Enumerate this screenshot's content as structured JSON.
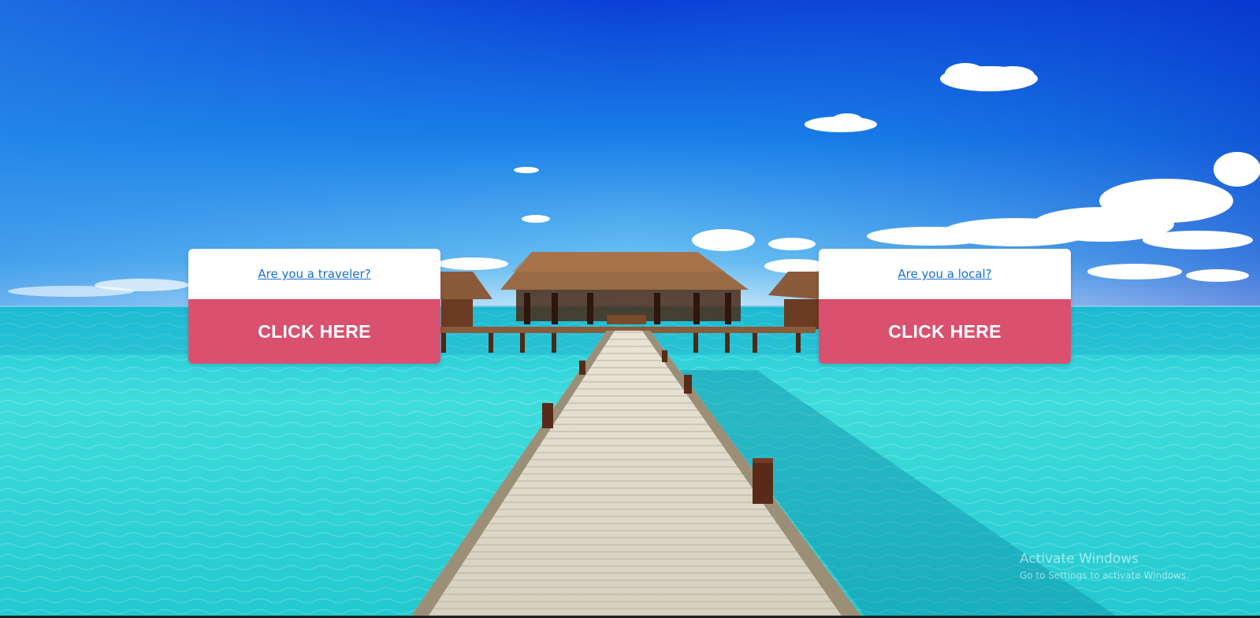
{
  "traveler_card": {
    "question": "Are you a traveler?",
    "button_label": "CLICK HERE"
  },
  "local_card": {
    "question": "Are you a local?",
    "button_label": "CLICK HERE"
  },
  "watermark": {
    "title": "Activate Windows",
    "subtitle": "Go to Settings to activate Windows."
  },
  "colors": {
    "button": "#d9516f",
    "link": "#1a6fd0",
    "sky": "#0a5fdc",
    "water": "#2fd6d8"
  }
}
